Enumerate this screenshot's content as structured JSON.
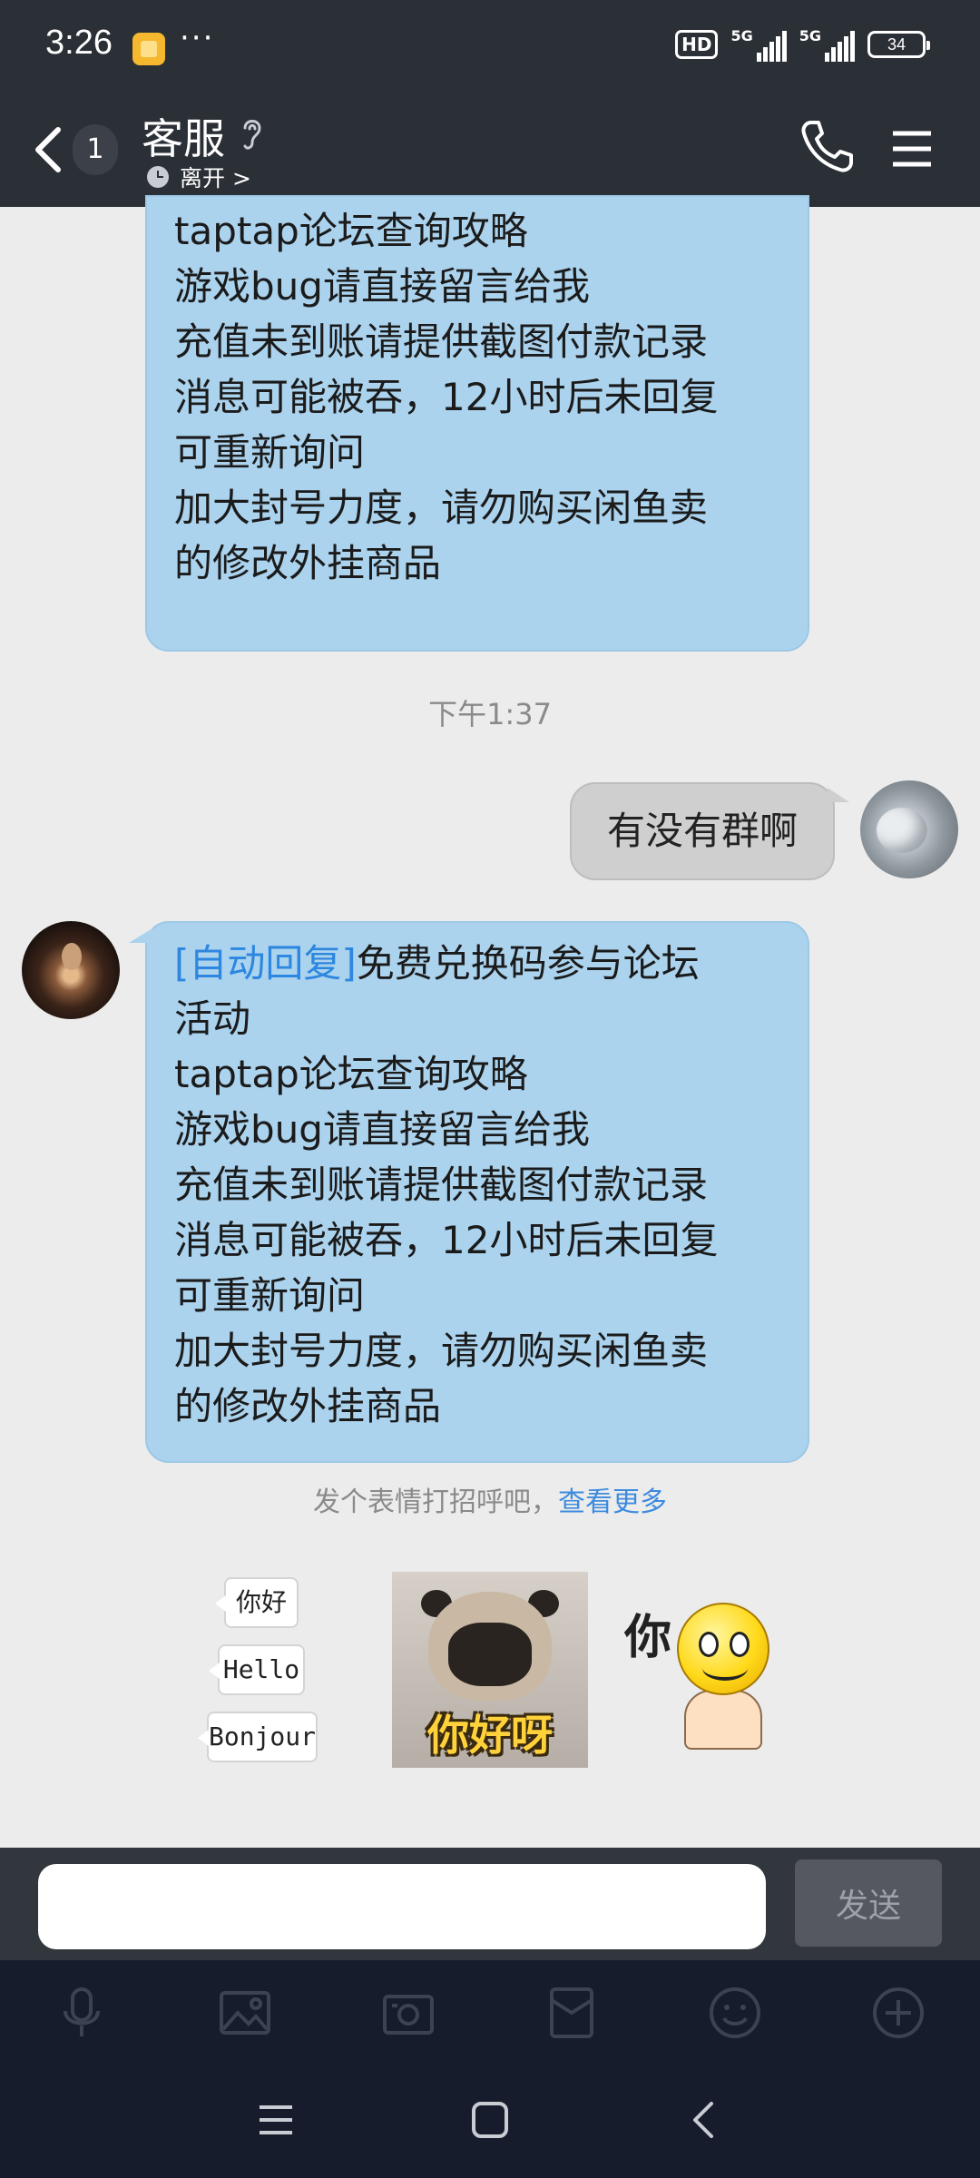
{
  "status_bar": {
    "time": "3:26",
    "dots": "···",
    "hd_label": "HD",
    "network_label_1": "5G",
    "network_label_2": "5G",
    "battery": "34"
  },
  "header": {
    "unread_count": "1",
    "title": "客服",
    "presence": "离开 >"
  },
  "messages": {
    "partial_reply_lines": "活动\ntaptap论坛查询攻略\n游戏bug请直接留言给我\n充值未到账请提供截图付款记录\n消息可能被吞，12小时后未回复\n可重新询问\n加大封号力度，请勿购买闲鱼卖\n的修改外挂商品",
    "timestamp": "下午1:37",
    "my_message": "有没有群啊",
    "auto_tag": "[自动回复]",
    "auto_reply_body": "免费兑换码参与论坛\n活动\ntaptap论坛查询攻略\n游戏bug请直接留言给我\n充值未到账请提供截图付款记录\n消息可能被吞，12小时后未回复\n可重新询问\n加大封号力度，请勿购买闲鱼卖\n的修改外挂商品"
  },
  "suggestions": {
    "prompt": "发个表情打招呼吧，",
    "more_link": "查看更多",
    "greetings": [
      "你好",
      "Hello",
      "Bonjour"
    ],
    "pug_sticker_text": "你好呀",
    "smiley_sticker_text": "你"
  },
  "input": {
    "value": "",
    "send_label": "发送"
  },
  "toolbar_icons": [
    "microphone-icon",
    "image-icon",
    "camera-icon",
    "red-packet-icon",
    "emoji-icon",
    "plus-icon"
  ],
  "nav_icons": [
    "menu-icon",
    "home-icon",
    "back-icon"
  ],
  "colors": {
    "header_bg": "#2b2f36",
    "chat_bg": "#ececec",
    "received_bubble": "#abd3ee",
    "sent_bubble": "#cfcfcf",
    "accent_link": "#3d8bde",
    "toolbar_bg": "#161c2c"
  }
}
